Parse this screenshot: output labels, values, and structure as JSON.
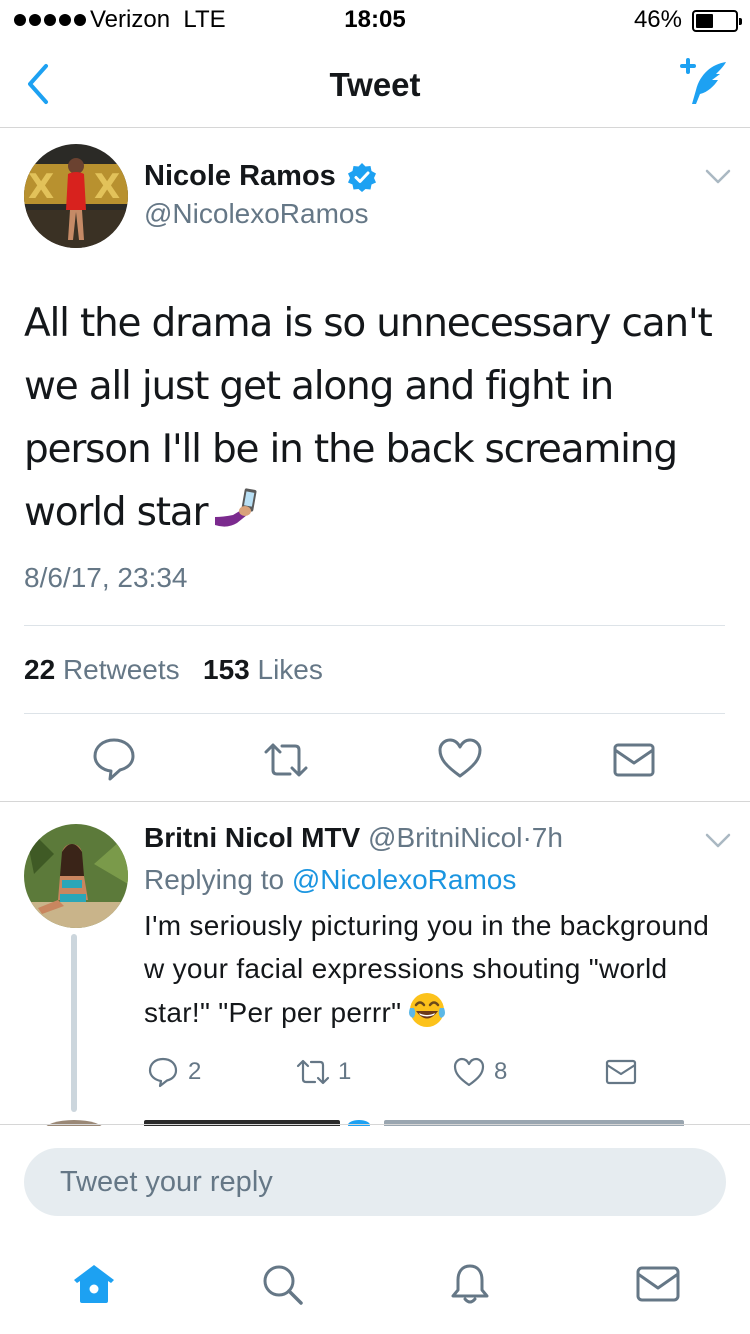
{
  "status_bar": {
    "carrier": "Verizon",
    "network": "LTE",
    "time": "18:05",
    "battery_percent_label": "46%",
    "battery_level": 0.46
  },
  "nav": {
    "title": "Tweet",
    "back_icon": "chevron-left-icon",
    "compose_icon": "compose-tweet-icon"
  },
  "tweet": {
    "author_name": "Nicole Ramos",
    "verified": true,
    "handle": "@NicolexoRamos",
    "text": "All the drama is so unnecessary can't we all just get along and fight in person I'll be in the back screaming world star",
    "emoji": "selfie-emoji",
    "timestamp": "8/6/17, 23:34",
    "retweets_count": "22",
    "retweets_label": "Retweets",
    "likes_count": "153",
    "likes_label": "Likes",
    "actions": [
      "reply-icon",
      "retweet-icon",
      "like-icon",
      "dm-icon"
    ]
  },
  "reply": {
    "author_name": "Britni Nicol MTV",
    "handle": "@BritniNicol",
    "separator": "·",
    "time": "7h",
    "replying_prefix": "Replying to",
    "replying_to": "@NicolexoRamos",
    "text": "I'm seriously picturing you in the background w your facial expressions shouting \"world star!\" \"Per per perrr\"",
    "emoji": "tears-of-joy-emoji",
    "reply_count": "2",
    "retweet_count": "1",
    "like_count": "8"
  },
  "reply_box": {
    "placeholder": "Tweet your reply"
  },
  "tab_bar": {
    "tabs": [
      "home-icon",
      "search-icon",
      "notifications-icon",
      "messages-icon"
    ],
    "active": "home-icon"
  },
  "colors": {
    "accent": "#1da1f2",
    "link": "#1b95e0",
    "secondary_text": "#657786",
    "primary_text": "#14171a",
    "divider": "#dde3e8",
    "input_bg": "#e6ecf0"
  }
}
